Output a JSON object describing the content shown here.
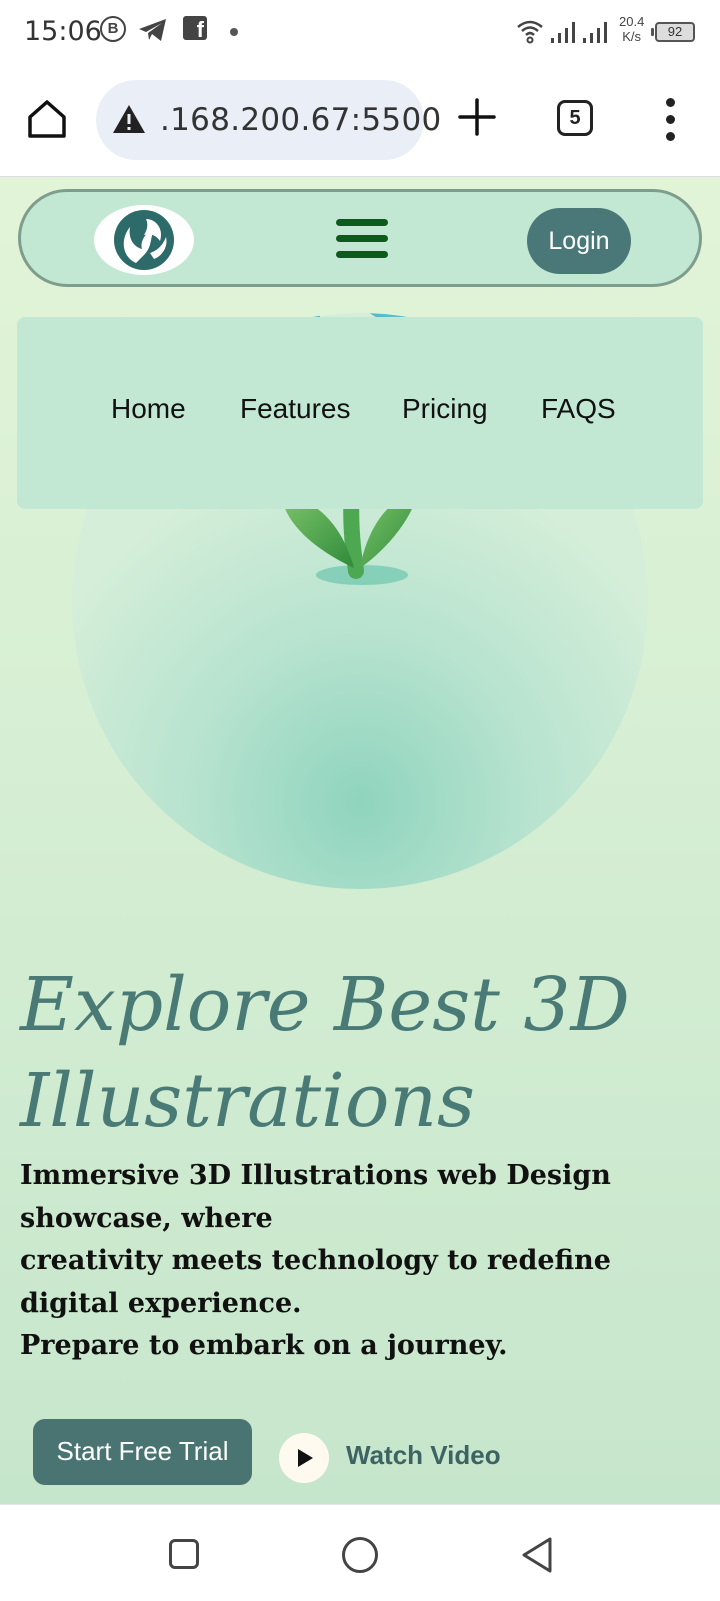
{
  "status_bar": {
    "time": "15:06",
    "b_icon": "B",
    "net_speed_value": "20.4",
    "net_speed_unit": "K/s",
    "battery": "92"
  },
  "browser": {
    "url": ".168.200.67:5500",
    "tab_count": "5"
  },
  "header": {
    "login_label": "Login"
  },
  "menu": {
    "items": [
      {
        "label": "Home"
      },
      {
        "label": "Features"
      },
      {
        "label": "Pricing"
      },
      {
        "label": "FAQS"
      }
    ]
  },
  "hero": {
    "title_line1": "Explore Best 3D",
    "title_line2": "Illustrations",
    "description": [
      "Immersive 3D Illustrations web Design showcase, where",
      "creativity meets technology to redefine digital experience.",
      "Prepare to embark on a journey."
    ],
    "cta_primary": "Start Free Trial",
    "cta_secondary": "Watch Video"
  },
  "icons": {
    "facebook": "f"
  }
}
